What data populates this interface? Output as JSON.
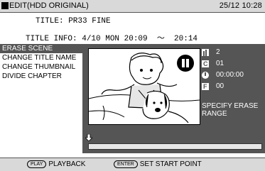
{
  "header": {
    "title": "EDIT(HDD ORIGINAL)",
    "datetime": "25/12 10:28"
  },
  "info": {
    "title_line": "TITLE: PR33 FINE",
    "title_info_line": "TITLE INFO: 4/10 MON 20:09  〜  20:14"
  },
  "menu": {
    "items": [
      {
        "label": "ERASE SCENE"
      },
      {
        "label": "CHANGE TITLE NAME"
      },
      {
        "label": "CHANGE THUMBNAIL"
      },
      {
        "label": "DIVIDE CHAPTER"
      }
    ]
  },
  "stats": {
    "title_number": "2",
    "chapter_number": "01",
    "time": "00:00:00",
    "frame_number": "00",
    "chapter_icon_letter": "C",
    "frame_icon_letter": "F"
  },
  "instruction": "SPECIFY ERASE RANGE",
  "footer": {
    "play_key": "PLAY",
    "play_label": "PLAYBACK",
    "enter_key": "ENTER",
    "enter_label": "SET START POINT"
  },
  "colors": {
    "header_bg": "#d9d9d9",
    "panel_bg": "#555555",
    "selected_bg": "#555555",
    "text_light": "#ffffff"
  },
  "icons": [
    "pause-icon",
    "title-icon",
    "chapter-icon",
    "clock-icon",
    "frame-icon",
    "position-arrow-icon"
  ]
}
